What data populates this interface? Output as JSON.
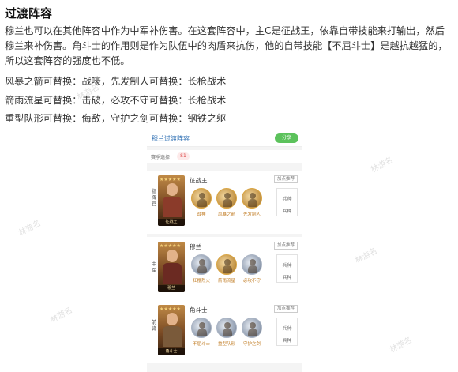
{
  "article": {
    "title": "过渡阵容",
    "intro": "穆兰也可以在其他阵容中作为中军补伤害。在这套阵容中，主C是征战王，依靠自带技能来打输出，然后穆兰来补伤害。角斗士的作用则是作为队伍中的肉盾来抗伤，他的自带技能【不屈斗士】是越抗越猛的，所以这套阵容的强度也不低。",
    "replacements": [
      "风暴之箭可替换：战嚎，先发制人可替换：长枪战术",
      "箭雨流星可替换：击破，必攻不守可替换：长枪战术",
      "重型队形可替换：侮敌，守护之剑可替换：钢铁之躯"
    ]
  },
  "watermark": "林游名",
  "lineup": {
    "title": "穆兰过渡阵容",
    "share_label": "分享",
    "season_label": "赛季选择",
    "season_value": "S1",
    "tag_label": "加点推荐",
    "weapon_label": "兵种",
    "weapon_placeholder": "兵种",
    "slots": [
      {
        "position": "指挥官",
        "name": "征战王",
        "card_caption": "征战王",
        "skills": [
          "战神",
          "风暴之箭",
          "先发制人"
        ]
      },
      {
        "position": "中军",
        "name": "穆兰",
        "card_caption": "穆兰",
        "skills": [
          "扛摆烈火",
          "箭雨流星",
          "必攻不守"
        ]
      },
      {
        "position": "前锋",
        "name": "角斗士",
        "card_caption": "角斗士",
        "skills": [
          "不屈斗士",
          "重型队形",
          "守护之剑"
        ]
      }
    ]
  }
}
